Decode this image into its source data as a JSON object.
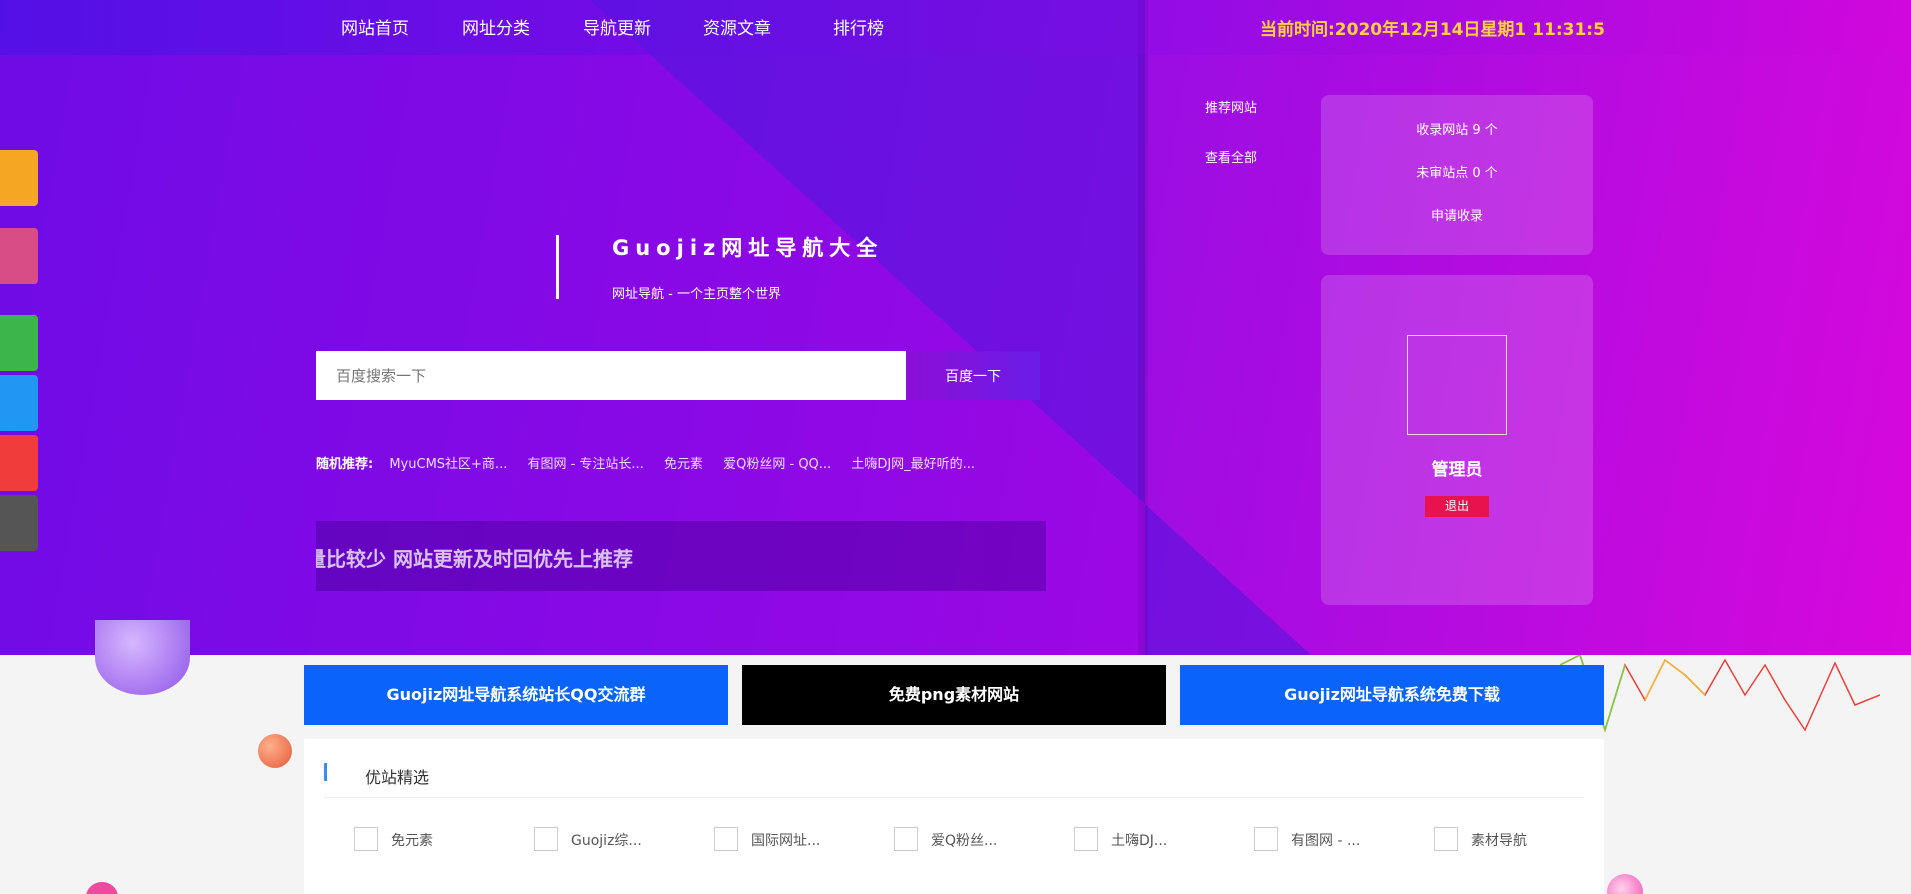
{
  "nav": {
    "items": [
      "网站首页",
      "网址分类",
      "导航更新",
      "资源文章",
      "排行榜"
    ],
    "clock": "当前时间:2020年12月14日星期1 11:31:5"
  },
  "side_tabs": [
    {
      "color": "#f5a623"
    },
    {
      "color": "#d84d86"
    },
    {
      "color": "#3cb54a"
    },
    {
      "color": "#2196f3"
    },
    {
      "color": "#f13c3c"
    },
    {
      "color": "#555555"
    }
  ],
  "brand": {
    "title": "Guojiz网址导航大全",
    "subtitle": "网址导航 - 一个主页整个世界"
  },
  "search": {
    "placeholder": "百度搜索一下",
    "button": "百度一下"
  },
  "random": {
    "label": "随机推荐:",
    "links": [
      "MyuCMS社区+商...",
      "有图网 - 专注站长...",
      "免元素",
      "爱Q粉丝网 - QQ...",
      "土嗨DJ网_最好听的..."
    ]
  },
  "marquee": "量比较少 网站更新及时回优先上推荐",
  "right_panel": {
    "links": [
      "推荐网站",
      "查看全部"
    ],
    "stats": [
      "收录网站 9 个",
      "未审站点 0 个",
      "申请收录"
    ],
    "admin": {
      "name": "管理员",
      "logout": "退出"
    }
  },
  "banners": [
    {
      "label": "Guojiz网址导航系统站长QQ交流群",
      "color": "#0a64fc"
    },
    {
      "label": "免费png素材网站",
      "color": "#000000"
    },
    {
      "label": "Guojiz网址导航系统免费下载",
      "color": "#0a64fc"
    }
  ],
  "featured": {
    "title": "优站精选",
    "sites": [
      "免元素",
      "Guojiz综...",
      "国际网址...",
      "爱Q粉丝...",
      "土嗨DJ...",
      "有图网 - ...",
      "素材导航"
    ]
  }
}
